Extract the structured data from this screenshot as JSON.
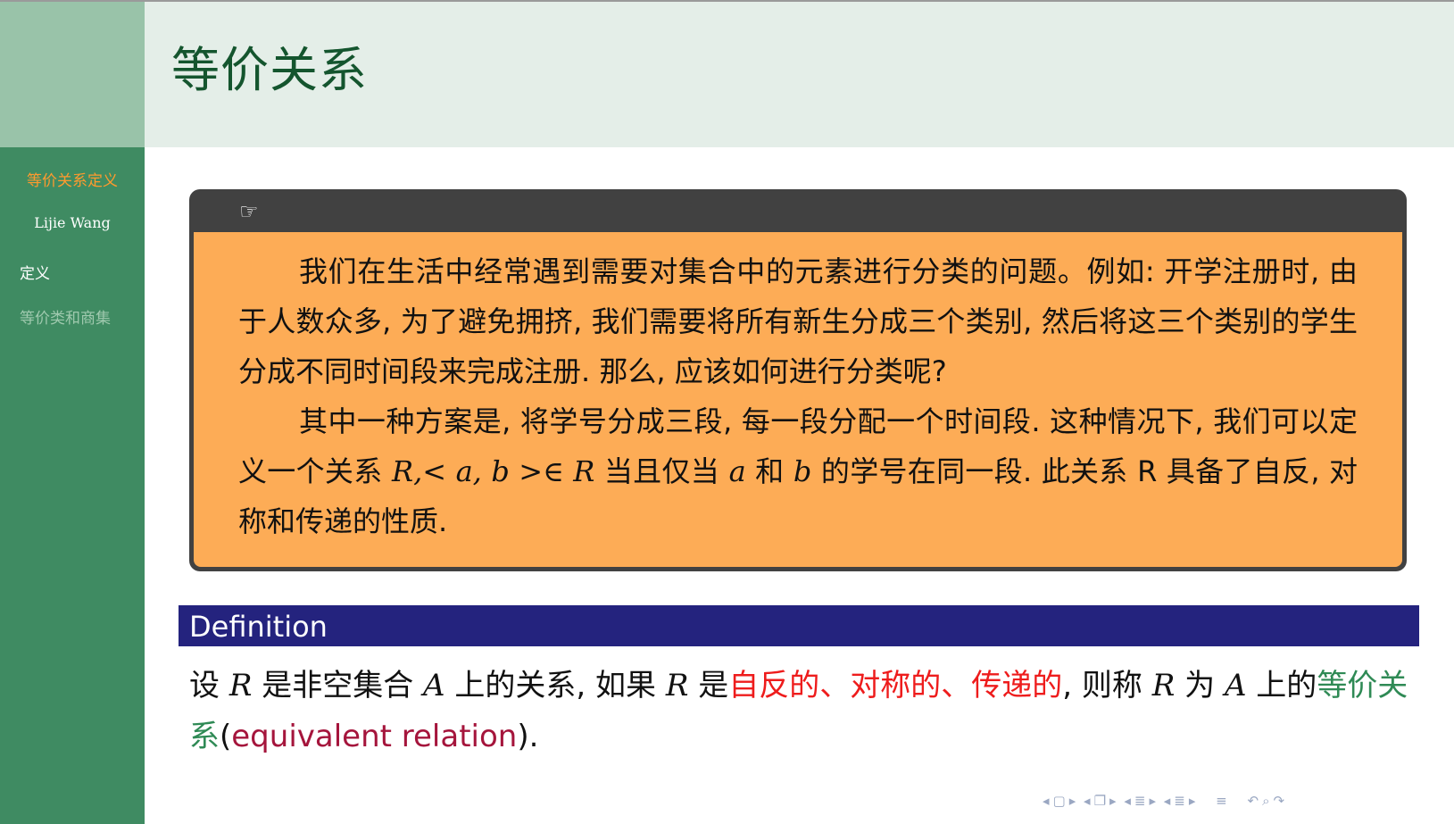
{
  "header": {
    "title": "等价关系"
  },
  "sidebar": {
    "title": "等价关系定义",
    "author": "Lijie Wang",
    "sections": [
      {
        "label": "定义",
        "active": true
      },
      {
        "label": "等价类和商集",
        "active": false
      }
    ]
  },
  "box": {
    "icon": "pointing-hand-icon",
    "p1": "我们在生活中经常遇到需要对集合中的元素进行分类的问题。例如: 开学注册时, 由于人数众多, 为了避免拥挤, 我们需要将所有新生分成三个类别, 然后将这三个类别的学生分成不同时间段来完成注册. 那么, 应该如何进行分类呢?",
    "p2_a": "其中一种方案是, 将学号分成三段, 每一段分配一个时间段. 这种情况下, 我们可以定义一个关系 ",
    "p2_math1": "R,< a, b >∈ R",
    "p2_b": " 当且仅当 ",
    "p2_math2": "a",
    "p2_c": " 和 ",
    "p2_math3": "b",
    "p2_d": " 的学号在同一段. 此关系 R 具备了自反, 对称和传递的性质."
  },
  "definition": {
    "heading": "Definition",
    "t1": "设 ",
    "m1": "R",
    "t2": " 是非空集合 ",
    "m2": "A",
    "t3": " 上的关系, 如果 ",
    "m3": "R",
    "t4": " 是",
    "red": "自反的、对称的、传递的",
    "t5": ", 则称 ",
    "m4": "R",
    "t6": " 为 ",
    "m5": "A",
    "t7": " 上的",
    "green": "等价关系",
    "t8": "(",
    "maroon": "equivalent relation",
    "t9": ")."
  },
  "nav": {
    "icons": [
      "nav-prev-icon",
      "frame-icon",
      "nav-next-icon",
      "nav-prev-icon",
      "subsection-icon",
      "nav-next-icon",
      "nav-prev-icon",
      "section-icon",
      "nav-next-icon",
      "nav-prev-icon",
      "section-icon",
      "nav-next-icon",
      "toc-icon",
      "undo-icon",
      "search-icon",
      "redo-icon"
    ]
  },
  "colors": {
    "sidebar": "#3f8b62",
    "header": "#e4eee8",
    "box_header": "#414141",
    "box_body": "#fdac56",
    "definition_bar": "#24237e",
    "highlight_red": "#ee1c1c",
    "highlight_green": "#2f8a55"
  }
}
